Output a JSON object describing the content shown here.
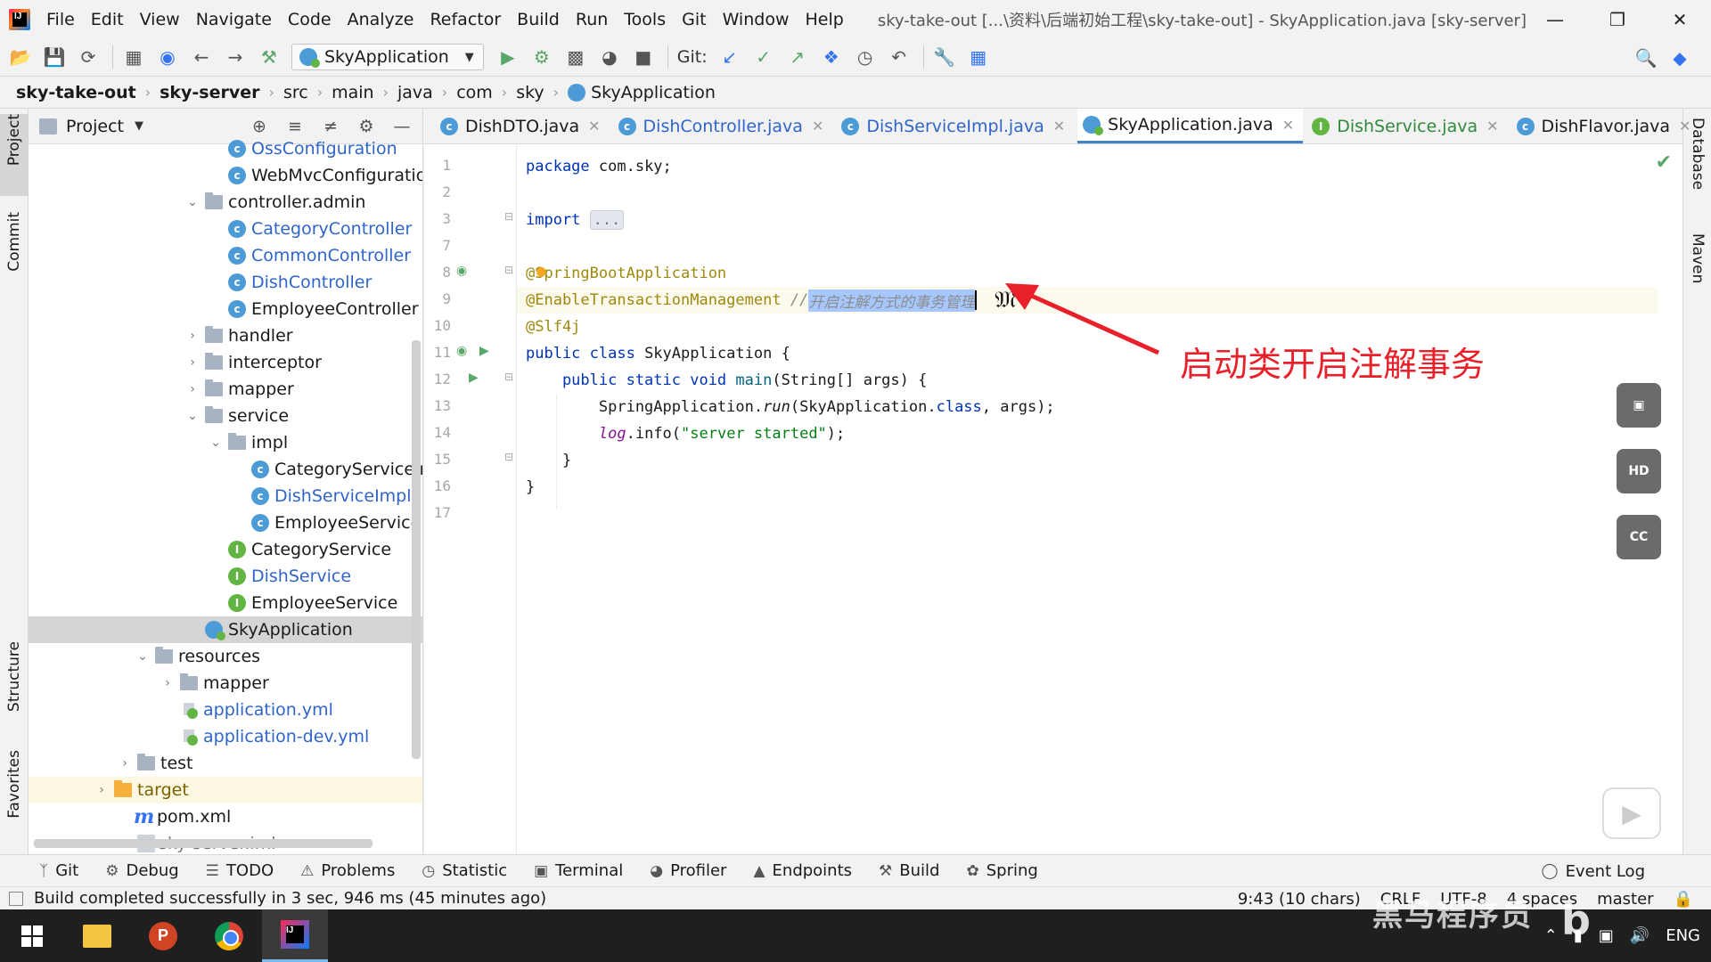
{
  "menubar": {
    "items": [
      "File",
      "Edit",
      "View",
      "Navigate",
      "Code",
      "Analyze",
      "Refactor",
      "Build",
      "Run",
      "Tools",
      "Git",
      "Window",
      "Help"
    ],
    "window_title": "sky-take-out [...\\资料\\后端初始工程\\sky-take-out] - SkyApplication.java [sky-server]"
  },
  "toolbar": {
    "run_config": "SkyApplication",
    "git_label": "Git:"
  },
  "breadcrumb": [
    "sky-take-out",
    "sky-server",
    "src",
    "main",
    "java",
    "com",
    "sky",
    "SkyApplication"
  ],
  "left_strip": [
    "Project",
    "Commit",
    "Structure",
    "Favorites"
  ],
  "right_strip": [
    "Database",
    "Maven"
  ],
  "project_panel": {
    "title": "Project",
    "tree": [
      {
        "label": "OssConfiguration",
        "icon": "class",
        "color": "blue"
      },
      {
        "label": "WebMvcConfiguration",
        "icon": "class",
        "color": "default"
      },
      {
        "label": "controller.admin",
        "icon": "package",
        "color": "default"
      },
      {
        "label": "CategoryController",
        "icon": "class",
        "color": "blue"
      },
      {
        "label": "CommonController",
        "icon": "class",
        "color": "blue"
      },
      {
        "label": "DishController",
        "icon": "class",
        "color": "blue"
      },
      {
        "label": "EmployeeController",
        "icon": "class",
        "color": "default"
      },
      {
        "label": "handler",
        "icon": "package",
        "color": "default"
      },
      {
        "label": "interceptor",
        "icon": "package",
        "color": "default"
      },
      {
        "label": "mapper",
        "icon": "package",
        "color": "default"
      },
      {
        "label": "service",
        "icon": "package",
        "color": "default"
      },
      {
        "label": "impl",
        "icon": "package",
        "color": "default"
      },
      {
        "label": "CategoryServiceImpl",
        "icon": "class",
        "color": "default"
      },
      {
        "label": "DishServiceImpl",
        "icon": "class",
        "color": "blue"
      },
      {
        "label": "EmployeeServiceImpl",
        "icon": "class",
        "color": "default"
      },
      {
        "label": "CategoryService",
        "icon": "interface",
        "color": "default"
      },
      {
        "label": "DishService",
        "icon": "interface",
        "color": "blue"
      },
      {
        "label": "EmployeeService",
        "icon": "interface",
        "color": "default"
      },
      {
        "label": "SkyApplication",
        "icon": "springboot",
        "color": "default"
      },
      {
        "label": "resources",
        "icon": "folder",
        "color": "default"
      },
      {
        "label": "mapper",
        "icon": "folder",
        "color": "default"
      },
      {
        "label": "application.yml",
        "icon": "yml",
        "color": "blue"
      },
      {
        "label": "application-dev.yml",
        "icon": "yml",
        "color": "blue"
      },
      {
        "label": "test",
        "icon": "folder",
        "color": "default"
      },
      {
        "label": "target",
        "icon": "folder-orange",
        "color": "brown"
      },
      {
        "label": "pom.xml",
        "icon": "maven",
        "color": "default"
      },
      {
        "label": "sky-server.iml",
        "icon": "iml",
        "color": "gray"
      }
    ]
  },
  "editor": {
    "tabs": [
      {
        "label": "DishDTO.java",
        "icon": "class",
        "color": "default"
      },
      {
        "label": "DishController.java",
        "icon": "class",
        "color": "blue"
      },
      {
        "label": "DishServiceImpl.java",
        "icon": "class",
        "color": "blue"
      },
      {
        "label": "SkyApplication.java",
        "icon": "springboot",
        "color": "default"
      },
      {
        "label": "DishService.java",
        "icon": "interface",
        "color": "green"
      },
      {
        "label": "DishFlavor.java",
        "icon": "class",
        "color": "default"
      }
    ],
    "line_numbers": [
      "1",
      "2",
      "3",
      "7",
      "8",
      "9",
      "10",
      "11",
      "12",
      "13",
      "14",
      "15",
      "16",
      "17"
    ],
    "code": {
      "l1_kw": "package",
      "l1_rest": " com.sky;",
      "l3_kw": "import",
      "l3_fold": "...",
      "l8": "@SpringBootApplication",
      "l9_ann": "@EnableTransactionManagement",
      "l9_cmt_pre": " //",
      "l9_cmt_sel": "开启注解方式的事务管理",
      "l10": "@Slf4j",
      "l11_kw": "public class",
      "l11_rest": " SkyApplication {",
      "l12_kw": "    public static void",
      "l12_fn": " main",
      "l12_rest": "(String[] args) {",
      "l13_pre": "        SpringApplication.",
      "l13_fn": "run",
      "l13_mid": "(SkyApplication.",
      "l13_kw": "class",
      "l13_rest": ", args);",
      "l14_pre": "        ",
      "l14_log": "log",
      "l14_mid": ".info(",
      "l14_str": "\"server started\"",
      "l14_rest": ");",
      "l15": "    }",
      "l16": "}"
    },
    "annotation": "启动类开启注解事务"
  },
  "side_buttons": [
    "HD",
    "CC"
  ],
  "bottom_tools": [
    "Git",
    "Debug",
    "TODO",
    "Problems",
    "Statistic",
    "Terminal",
    "Profiler",
    "Endpoints",
    "Build",
    "Spring"
  ],
  "bottom_right": "Event Log",
  "status": {
    "message": "Build completed successfully in 3 sec, 946 ms (45 minutes ago)",
    "position": "9:43 (10 chars)",
    "line_sep": "CRLF",
    "encoding": "UTF-8",
    "indent": "4 spaces",
    "branch": "master"
  },
  "watermark": "黑马程序员",
  "taskbar": {
    "tray_lang": "ENG"
  }
}
